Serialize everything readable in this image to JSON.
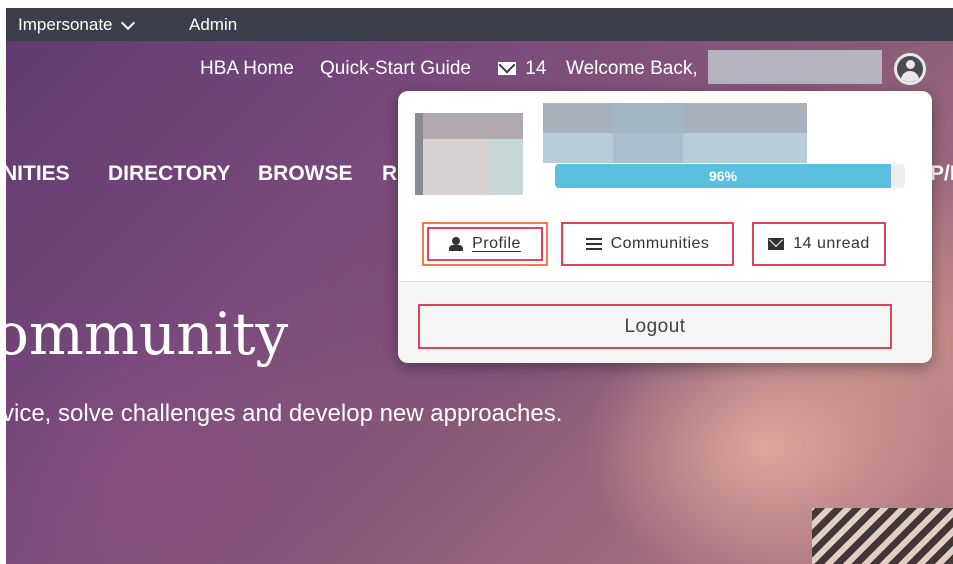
{
  "topbar": {
    "impersonate_label": "Impersonate",
    "admin_label": "Admin"
  },
  "utility_nav": {
    "home_label": "HBA Home",
    "guide_label": "Quick-Start Guide",
    "messages_count": "14",
    "welcome_text": "Welcome Back,"
  },
  "main_nav": {
    "items": [
      "NITIES",
      "DIRECTORY",
      "BROWSE",
      "RE",
      "P/F"
    ]
  },
  "hero": {
    "title": "ommunity",
    "subtitle": "vice, solve challenges and develop new approaches."
  },
  "dropdown": {
    "profile_completion_text": "96%",
    "profile_completion": 0.96,
    "profile_button": "Profile",
    "communities_button": "Communities",
    "unread_button": "14 unread",
    "logout_button": "Logout"
  },
  "colors": {
    "topbar": "#3c3f4b",
    "progress_fill": "#5bbfdf",
    "highlight_border": "#e0435a",
    "focus_border": "#f07a4a"
  },
  "icons": [
    "chevron-down-icon",
    "envelope-icon",
    "user-icon",
    "list-icon"
  ]
}
